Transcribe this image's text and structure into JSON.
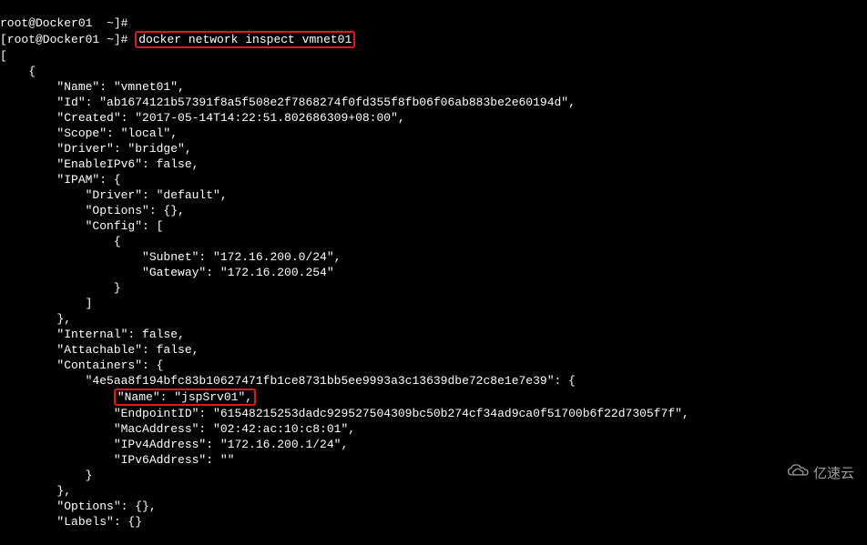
{
  "terminal": {
    "prompt_line_prefix": "[root@Docker01 ~]# ",
    "command": "docker network inspect vmnet01",
    "cut_top": "root@Docker01  ~]#",
    "json_lines": [
      "[",
      "    {",
      "        \"Name\": \"vmnet01\",",
      "        \"Id\": \"ab1674121b57391f8a5f508e2f7868274f0fd355f8fb06f06ab883be2e60194d\",",
      "        \"Created\": \"2017-05-14T14:22:51.802686309+08:00\",",
      "        \"Scope\": \"local\",",
      "        \"Driver\": \"bridge\",",
      "        \"EnableIPv6\": false,",
      "        \"IPAM\": {",
      "            \"Driver\": \"default\",",
      "            \"Options\": {},",
      "            \"Config\": [",
      "                {",
      "                    \"Subnet\": \"172.16.200.0/24\",",
      "                    \"Gateway\": \"172.16.200.254\"",
      "                }",
      "            ]",
      "        },",
      "        \"Internal\": false,",
      "        \"Attachable\": false,",
      "        \"Containers\": {",
      "            \"4e5aa8f194bfc83b10627471fb1ce8731bb5ee9993a3c13639dbe72c8e1e7e39\": {",
      "                \"EndpointID\": \"61548215253dadc929527504309bc50b274cf34ad9ca0f51700b6f22d7305f7f\",",
      "                \"MacAddress\": \"02:42:ac:10:c8:01\",",
      "                \"IPv4Address\": \"172.16.200.1/24\",",
      "                \"IPv6Address\": \"\"",
      "            }",
      "        },",
      "        \"Options\": {},",
      "        \"Labels\": {}"
    ],
    "highlighted_container_name": "\"Name\": \"jspSrv01\","
  },
  "watermark": {
    "text": "亿速云"
  }
}
